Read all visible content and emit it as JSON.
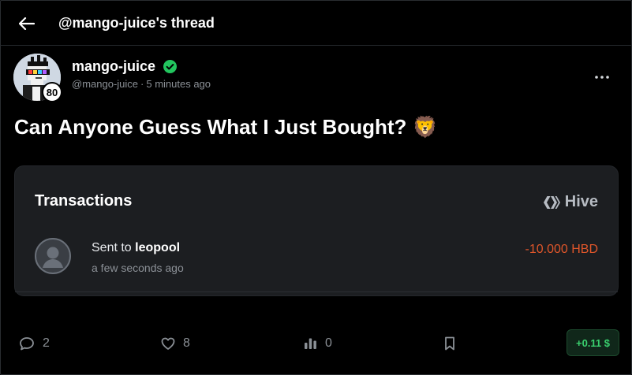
{
  "header": {
    "title": "@mango-juice's thread"
  },
  "author": {
    "name": "mango-juice",
    "handle": "@mango-juice",
    "separator": "·",
    "time_ago": "5 minutes ago",
    "reputation": "80"
  },
  "post": {
    "title": "Can Anyone Guess What I Just Bought? 🦁"
  },
  "transactions_card": {
    "title": "Transactions",
    "network": "Hive",
    "item": {
      "prefix": "Sent to ",
      "recipient": "leopool",
      "time": "a few seconds ago",
      "amount": "-10.000 HBD"
    }
  },
  "actions": {
    "comments": "2",
    "likes": "8",
    "views": "0",
    "payout": "+0.11 $"
  },
  "colors": {
    "background": "#000000",
    "card": "#1c1e21",
    "verified": "#22c55e",
    "amount_negative": "#e0562a",
    "payout_text": "#3ad06e"
  }
}
